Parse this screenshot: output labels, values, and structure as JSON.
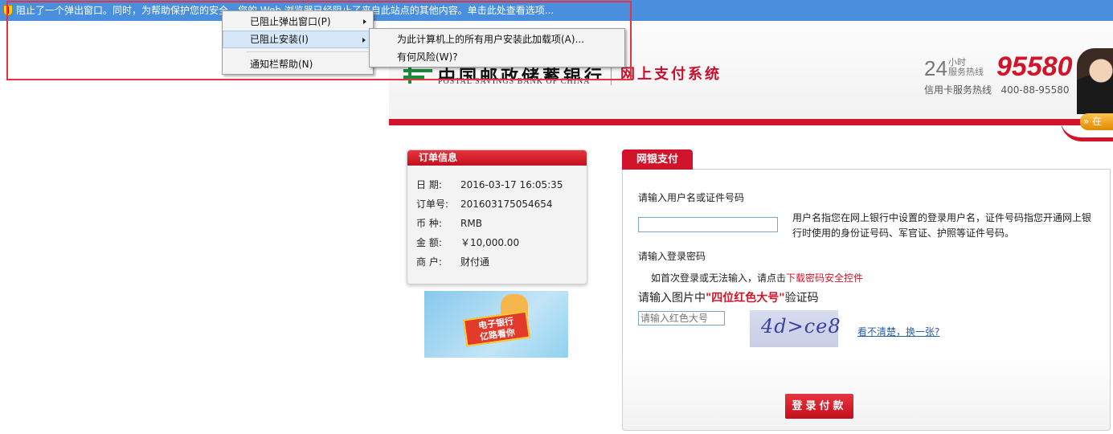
{
  "infobar": {
    "message": "阻止了一个弹出窗口。同时，为帮助保护您的安全，您的 Web 浏览器已经阻止了来自此站点的其他内容。单击此处查看选项..."
  },
  "menu_main": {
    "items": [
      "已阻止弹出窗口(P)",
      "已阻止安装(I)",
      "通知栏帮助(N)"
    ]
  },
  "menu_sub": {
    "items": [
      "为此计算机上的所有用户安装此加载项(A)...",
      "有何风险(W)?"
    ]
  },
  "header": {
    "bank_cn": "中国邮政储蓄银行",
    "bank_en": "POSTAL SAVINGS BANK OF CHINA",
    "system_title": "网上支付系统",
    "hours_big": "24",
    "hours_small_1": "小时",
    "hours_small_2": "服务热线",
    "hotline": "95580",
    "credit_label": "信用卡服务热线",
    "credit_number": "400-88-95580",
    "online_label": "在"
  },
  "order": {
    "title": "订单信息",
    "rows": [
      {
        "k": "日  期:",
        "v": "2016-03-17 16:05:35"
      },
      {
        "k": "订单号:",
        "v": "201603175054654"
      },
      {
        "k": "币  种:",
        "v": "RMB"
      },
      {
        "k": "金  额:",
        "v": "￥10,000.00"
      },
      {
        "k": "商  户:",
        "v": "财付通"
      }
    ]
  },
  "banner": {
    "text_1": "电子银行",
    "text_2": "亿路看你"
  },
  "login": {
    "tab": "网银支付",
    "username_label": "请输入用户名或证件号码",
    "username_hint": "用户名指您在网上银行中设置的登录用户名，证件号码指您开通网上银行时使用的身份证号码、军官证、护照等证件号码。",
    "password_label": "请输入登录密码",
    "password_hint_prefix": "如首次登录或无法输入，请点击",
    "password_hint_link": "下载密码安全控件",
    "captcha_prefix": "请输入图片中",
    "captcha_highlight": "\"四位红色大号\"",
    "captcha_suffix": "验证码",
    "captcha_placeholder": "请输入红色大号",
    "captcha_image_text": "4d>ce8",
    "refresh": "看不清楚，换一张?",
    "submit": "登录付款"
  }
}
